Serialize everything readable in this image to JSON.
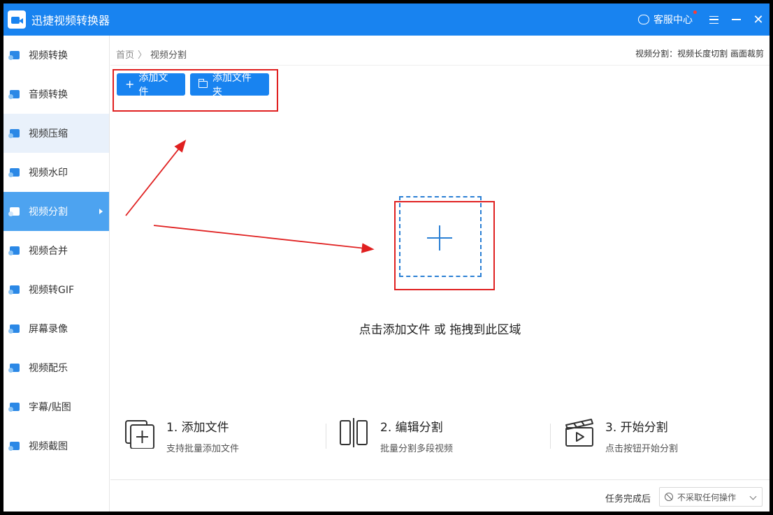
{
  "app": {
    "title": "迅捷视频转换器",
    "service_label": "客服中心"
  },
  "sidebar": {
    "items": [
      {
        "label": "视频转换",
        "icon": "video-convert-icon"
      },
      {
        "label": "音频转换",
        "icon": "audio-convert-icon"
      },
      {
        "label": "视频压缩",
        "icon": "video-compress-icon"
      },
      {
        "label": "视频水印",
        "icon": "video-watermark-icon"
      },
      {
        "label": "视频分割",
        "icon": "video-split-icon"
      },
      {
        "label": "视频合并",
        "icon": "video-merge-icon"
      },
      {
        "label": "视频转GIF",
        "icon": "video-gif-icon"
      },
      {
        "label": "屏幕录像",
        "icon": "screen-record-icon"
      },
      {
        "label": "视频配乐",
        "icon": "video-music-icon"
      },
      {
        "label": "字幕/贴图",
        "icon": "subtitle-sticker-icon"
      },
      {
        "label": "视频截图",
        "icon": "video-screenshot-icon"
      }
    ],
    "active_index": 4
  },
  "breadcrumb": {
    "home": "首页",
    "separator": "〉",
    "current": "视频分割",
    "right_text": "视频分割：视频长度切割 画面裁剪"
  },
  "toolbar": {
    "add_file": "添加文件",
    "add_folder": "添加文件夹"
  },
  "dropzone": {
    "hint": "点击添加文件 或 拖拽到此区域"
  },
  "steps": [
    {
      "title": "1. 添加文件",
      "subtitle": "支持批量添加文件"
    },
    {
      "title": "2. 编辑分割",
      "subtitle": "批量分割多段视频"
    },
    {
      "title": "3. 开始分割",
      "subtitle": "点击按钮开始分割"
    }
  ],
  "footer": {
    "label": "任务完成后",
    "select_value": "不采取任何操作"
  },
  "colors": {
    "primary": "#1883f0",
    "sidebar_active": "#4da3f0",
    "highlight": "#e02020"
  }
}
